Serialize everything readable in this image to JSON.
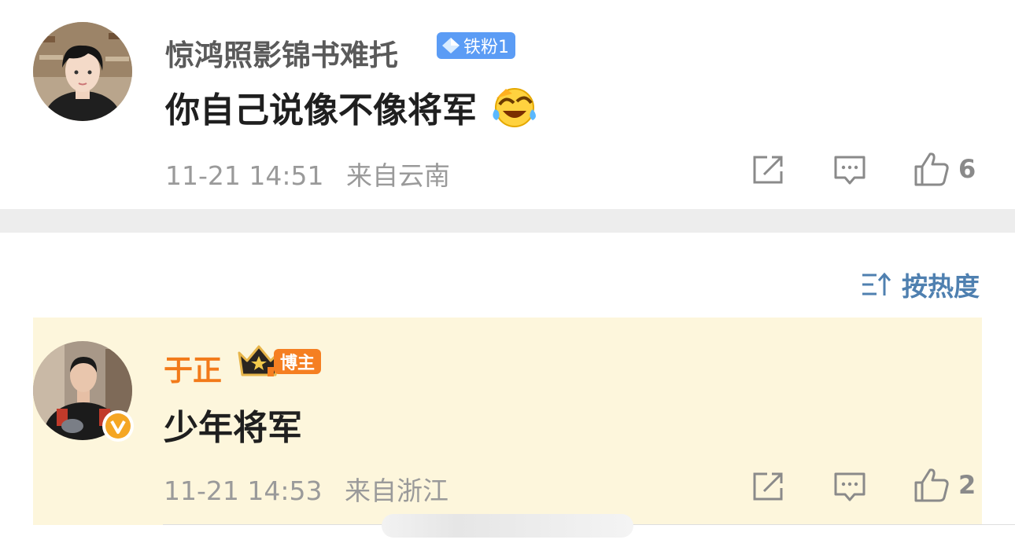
{
  "comments": [
    {
      "user_name": "惊鸿照影锦书难托",
      "badge": "铁粉1",
      "text": "你自己说像不像将军",
      "emoji": "laughing-crying-emoji",
      "time": "11-21 14:51",
      "location": "来自云南",
      "likes": "6"
    },
    {
      "user_name": "于正",
      "badge": "博主",
      "text": "少年将军",
      "time": "11-21 14:53",
      "location": "来自浙江",
      "likes": "2"
    }
  ],
  "sort": {
    "label": "按热度"
  },
  "colors": {
    "username_default": "#5a5a5a",
    "username_blogger": "#f27a1a",
    "highlight_bg": "#fdf6dc",
    "sort_accent": "#4f80b0"
  }
}
